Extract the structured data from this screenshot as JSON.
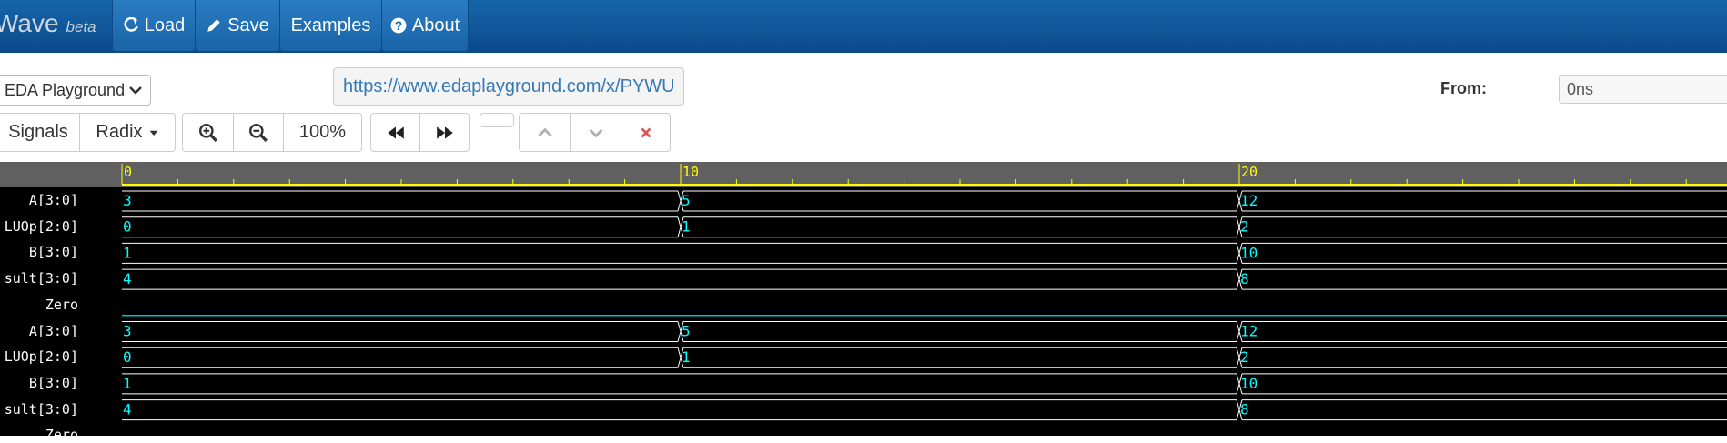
{
  "app": {
    "title_partial": "Wave",
    "beta": "beta"
  },
  "nav": [
    {
      "id": "load",
      "label": "Load",
      "icon": "refresh-icon"
    },
    {
      "id": "save",
      "label": "Save",
      "icon": "pencil-icon"
    },
    {
      "id": "examples",
      "label": "Examples"
    },
    {
      "id": "about",
      "label": "About",
      "icon": "question-circle-icon"
    }
  ],
  "source_select": {
    "value": "EDA Playground"
  },
  "url": {
    "value": "https://www.edaplayground.com/x/PYWU"
  },
  "from": {
    "label": "From:",
    "value": "0ns"
  },
  "toolbar": {
    "signals": "Signals",
    "radix": "Radix",
    "zoom": "100%"
  },
  "timeline": {
    "ticks": [
      "0",
      "10",
      "20"
    ]
  },
  "signals": [
    {
      "name": "A[3:0]",
      "values": [
        "3",
        "5",
        "12"
      ]
    },
    {
      "name": "LUOp[2:0]",
      "values": [
        "0",
        "1",
        "2"
      ]
    },
    {
      "name": "B[3:0]",
      "values": [
        "1",
        "10"
      ]
    },
    {
      "name": "sult[3:0]",
      "values": [
        "4",
        "8"
      ]
    },
    {
      "name": "Zero",
      "values": []
    },
    {
      "name": "A[3:0]",
      "values": [
        "3",
        "5",
        "12"
      ]
    },
    {
      "name": "LUOp[2:0]",
      "values": [
        "0",
        "1",
        "2"
      ]
    },
    {
      "name": "B[3:0]",
      "values": [
        "1",
        "10"
      ]
    },
    {
      "name": "sult[3:0]",
      "values": [
        "4",
        "8"
      ]
    },
    {
      "name": "Zero",
      "values": []
    }
  ],
  "colors": {
    "navbar": "#0b4a8c",
    "ruler": "#606060",
    "tick": "#ffff00",
    "value": "#00ffff",
    "trace": "#ffffff",
    "zero_line": "#00ffff",
    "clear": "#e05555"
  }
}
